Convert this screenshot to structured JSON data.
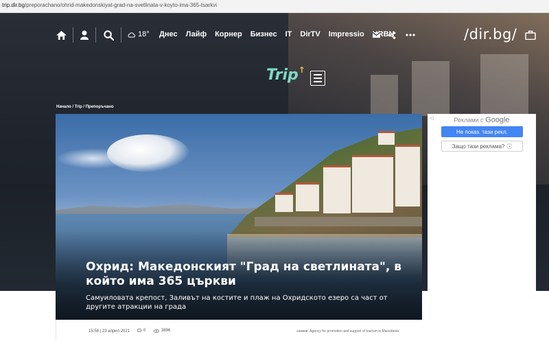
{
  "browser": {
    "url_host": "trip.dir.bg",
    "url_path": "/preporachano/ohrid-makedonskiyat-grad-na-svetlinata-v-koyto-ima-365-tsarkvi"
  },
  "nav": {
    "weather_temp": "18°",
    "links": [
      "Днес",
      "Лайф",
      "Корнер",
      "Бизнес",
      "IT",
      "DirTV",
      "Impressio",
      "URBN"
    ],
    "brand": "/dir.bg/"
  },
  "section": {
    "logo": "Trip",
    "breadcrumb": "Начало / Trip / Препоръчано"
  },
  "article": {
    "title": "Охрид: Македонският \"Град на светлината\", в който има 365 църкви",
    "subtitle": "Самуиловата крепост, Заливът на костите и плаж на Охридското езеро са част от другите атракции на града",
    "date": "15:58 | 23 април 2021",
    "comments": "0",
    "views": "3896",
    "photo_credit": "снимки: Agency for promotion and support of tourism in Macedonia"
  },
  "ads": {
    "header_prefix": "Реклами с",
    "header_brand": "Google",
    "stop_button": "Не показ. тази рекл.",
    "why_button": "Защо тази реклама?"
  }
}
